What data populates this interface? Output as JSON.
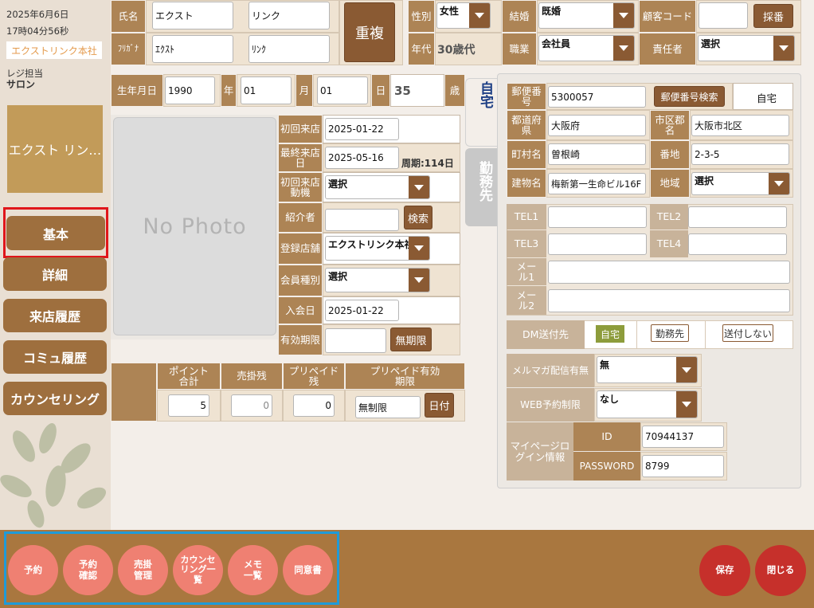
{
  "sidebar": {
    "date": "2025年6月6日",
    "time": "17時04分56秒",
    "store": "エクストリンク本社",
    "register_label": "レジ担当",
    "register_value": "サロン",
    "staff_name": "エクスト リン…",
    "nav": [
      "基本",
      "詳細",
      "来店履歴",
      "コミュ履歴",
      "カウンセリング"
    ]
  },
  "header": {
    "name_label": "氏名",
    "last_name": "エクスト",
    "first_name": "リンク",
    "kana_label": "ﾌﾘｶﾞﾅ",
    "last_kana": "ｴｸｽﾄ",
    "first_kana": "ﾘﾝｸ",
    "duplicate_button": "重複",
    "gender_label": "性別",
    "gender_value": "女性",
    "marital_label": "結婚",
    "marital_value": "既婚",
    "customer_code_label": "顧客コード",
    "customer_code_value": "",
    "assign_button": "採番",
    "age_group_label": "年代",
    "age_group_value": "30歳代",
    "job_label": "職業",
    "job_value": "会社員",
    "manager_label": "責任者",
    "manager_value": "選択"
  },
  "birth": {
    "label": "生年月日",
    "year": "1990",
    "year_unit": "年",
    "month": "01",
    "month_unit": "月",
    "day": "01",
    "day_unit": "日",
    "age": "35",
    "age_unit": "歳"
  },
  "photo": {
    "placeholder": "No Photo"
  },
  "visit": {
    "first_visit_label": "初回来店",
    "first_visit_value": "2025-01-22",
    "last_visit_label": "最終来店日",
    "last_visit_value": "2025-05-16",
    "cycle_text": "周期:114日",
    "motive_label": "初回来店動機",
    "motive_value": "選択",
    "referrer_label": "紹介者",
    "referrer_value": "",
    "search_button": "検索",
    "reg_store_label": "登録店舗",
    "reg_store_value": "エクストリンク本社",
    "member_type_label": "会員種別",
    "member_type_value": "選択",
    "join_label": "入会日",
    "join_value": "2025-01-22",
    "expiry_label": "有効期限",
    "expiry_value": "",
    "unlimited_button": "無期限"
  },
  "points": {
    "points_label": "ポイント合計",
    "points_value": "5",
    "credit_label": "売掛残",
    "credit_value": "0",
    "prepaid_label": "プリペイド残",
    "prepaid_value": "0",
    "prepaid_exp_label": "プリペイド有効期限",
    "prepaid_exp_value": "無制限",
    "date_button": "日付"
  },
  "tabs": {
    "home": "自宅",
    "work": "勤務先"
  },
  "address": {
    "zip_label": "郵便番号",
    "zip_value": "5300057",
    "zip_search_button": "郵便番号検索",
    "home_text": "自宅",
    "pref_label": "都道府県",
    "pref_value": "大阪府",
    "city_label": "市区郡名",
    "city_value": "大阪市北区",
    "town_label": "町村名",
    "town_value": "曽根崎",
    "lot_label": "番地",
    "lot_value": "2-3-5",
    "building_label": "建物名",
    "building_value": "梅新第一生命ビル16F",
    "region_label": "地域",
    "region_value": "選択"
  },
  "contact": {
    "tel1_label": "TEL1",
    "tel2_label": "TEL2",
    "tel3_label": "TEL3",
    "tel4_label": "TEL4",
    "mail1_label": "メール1",
    "mail2_label": "メール2"
  },
  "dm": {
    "label": "DM送付先",
    "home": "自宅",
    "work": "勤務先",
    "none": "送付しない"
  },
  "web": {
    "mailmag_label": "メルマガ配信有無",
    "mailmag_value": "無",
    "web_limit_label": "WEB予約制限",
    "web_limit_value": "なし",
    "mypage_label": "マイページログイン情報",
    "id_label": "ID",
    "id_value": "70944137",
    "pw_label": "PASSWORD",
    "pw_value": "8799"
  },
  "footer": {
    "actions": [
      "予約",
      "予約確認",
      "売掛管理",
      "カウンセリング一覧",
      "メモ一覧",
      "同意書"
    ],
    "save": "保存",
    "close": "閉じる"
  },
  "colors": {
    "brown": "#ad8455",
    "dark_brown": "#8a5a33",
    "footer": "#a9773f",
    "salmon": "#ef8072",
    "red_button": "#c6302b",
    "highlight_red": "#e0161b",
    "highlight_blue": "#1f9bd8"
  }
}
